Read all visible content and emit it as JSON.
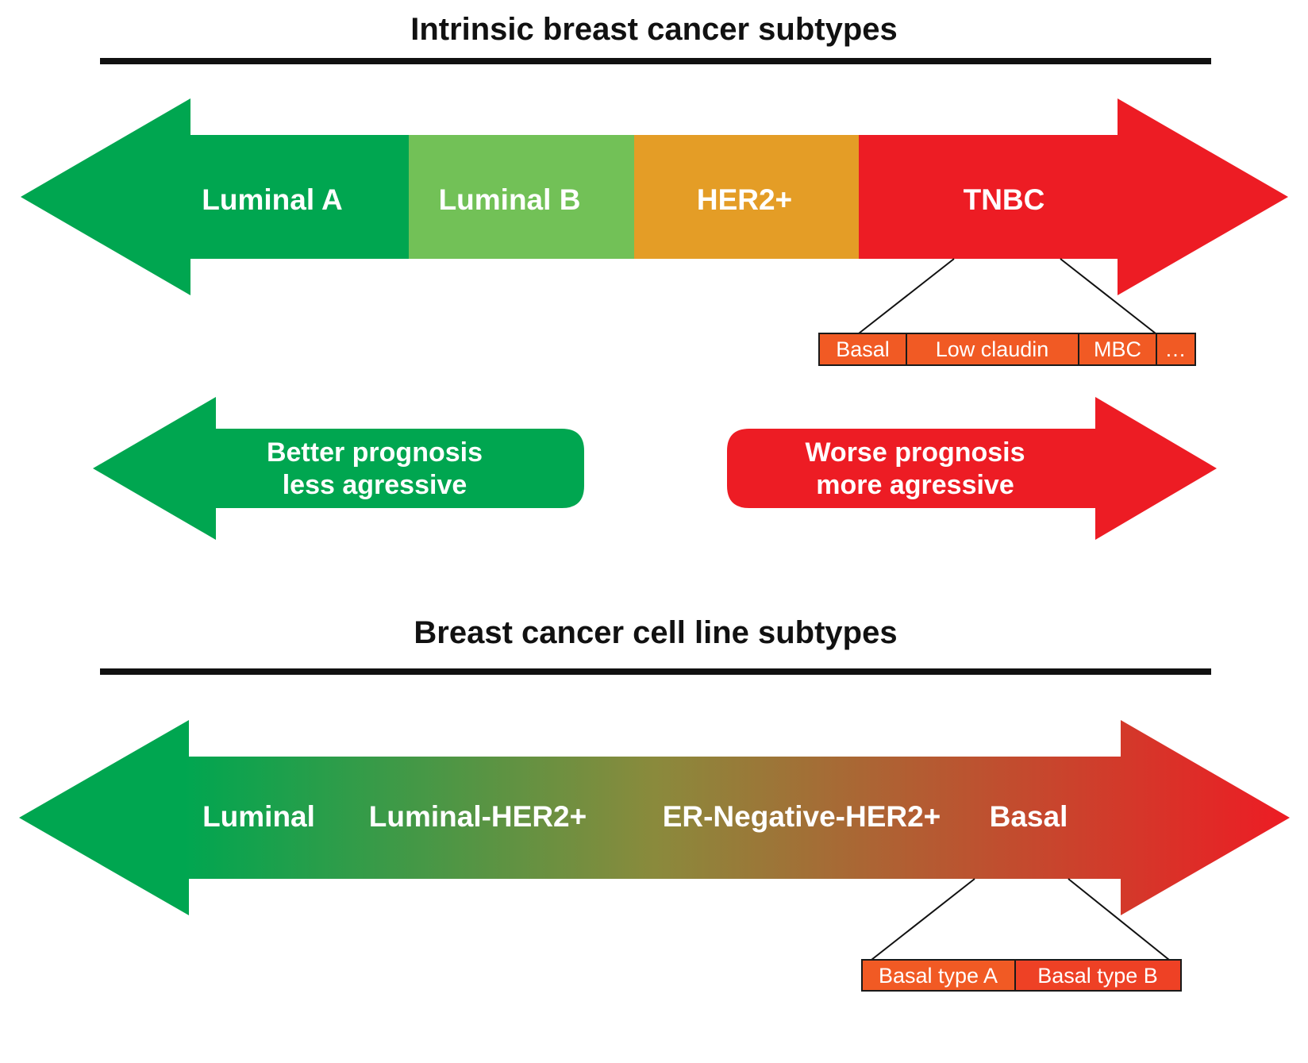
{
  "colors": {
    "green": "#00A650",
    "light_green": "#72C157",
    "orange": "#E49D26",
    "red": "#ED1C24",
    "subtype_box": "#F15A24",
    "subtype_box_b": "#EE4125",
    "text_dark": "#111111",
    "text_light": "#ffffff"
  },
  "section_top": {
    "title": "Intrinsic breast cancer subtypes",
    "bands": [
      {
        "label": "Luminal A",
        "color": "#00A650"
      },
      {
        "label": "Luminal B",
        "color": "#72C157"
      },
      {
        "label": "HER2+",
        "color": "#E49D26"
      },
      {
        "label": "TNBC",
        "color": "#ED1C24"
      }
    ],
    "tnbc_subtypes": [
      "Basal",
      "Low claudin",
      "MBC",
      "…"
    ]
  },
  "prognosis": {
    "better": {
      "line1": "Better prognosis",
      "line2": "less agressive"
    },
    "worse": {
      "line1": "Worse prognosis",
      "line2": "more agressive"
    }
  },
  "section_bottom": {
    "title": "Breast cancer cell line subtypes",
    "labels": [
      "Luminal",
      "Luminal-HER2+",
      "ER-Negative-HER2+",
      "Basal"
    ],
    "gradient_from": "#00A650",
    "gradient_to": "#ED1C24",
    "basal_subtypes": [
      "Basal type A",
      "Basal type B"
    ]
  }
}
